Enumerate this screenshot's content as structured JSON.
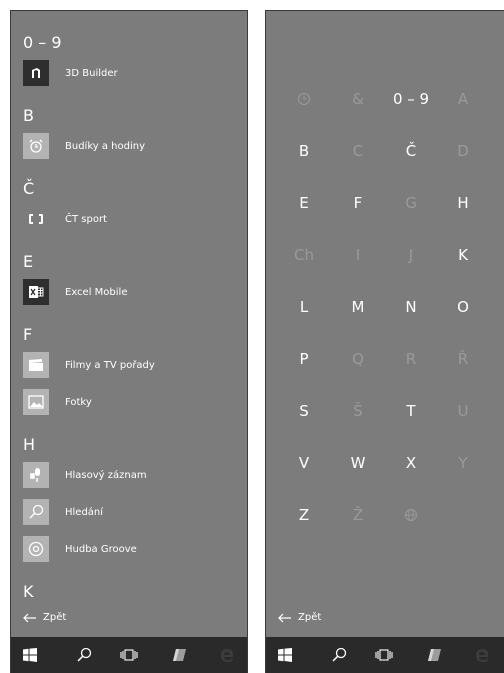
{
  "left_panel": {
    "groups": [
      {
        "letter": "0 – 9",
        "apps": [
          {
            "label": "3D Builder",
            "icon": "3d-builder-icon",
            "tile": "dark"
          }
        ]
      },
      {
        "letter": "B",
        "apps": [
          {
            "label": "Budíky a hodiny",
            "icon": "alarm-clock-icon",
            "tile": "light"
          }
        ]
      },
      {
        "letter": "Č",
        "apps": [
          {
            "label": "ČT sport",
            "icon": "ct-sport-icon",
            "tile": "none"
          }
        ]
      },
      {
        "letter": "E",
        "apps": [
          {
            "label": "Excel Mobile",
            "icon": "excel-icon",
            "tile": "dark"
          }
        ]
      },
      {
        "letter": "F",
        "apps": [
          {
            "label": "Filmy a TV pořady",
            "icon": "film-clapper-icon",
            "tile": "light"
          },
          {
            "label": "Fotky",
            "icon": "photos-icon",
            "tile": "light"
          }
        ]
      },
      {
        "letter": "H",
        "apps": [
          {
            "label": "Hlasový záznam",
            "icon": "microphone-icon",
            "tile": "light"
          },
          {
            "label": "Hledání",
            "icon": "search-icon",
            "tile": "light"
          },
          {
            "label": "Hudba Groove",
            "icon": "groove-music-icon",
            "tile": "light"
          }
        ]
      },
      {
        "letter": "K",
        "apps": []
      }
    ],
    "back_label": "Zpět"
  },
  "right_panel": {
    "grid": [
      [
        {
          "text": "",
          "icon": "recent-clock-icon",
          "active": false
        },
        {
          "text": "&",
          "active": false
        },
        {
          "text": "0 – 9",
          "active": true
        },
        {
          "text": "A",
          "active": false
        }
      ],
      [
        {
          "text": "B",
          "active": true
        },
        {
          "text": "C",
          "active": false
        },
        {
          "text": "Č",
          "active": true
        },
        {
          "text": "D",
          "active": false
        }
      ],
      [
        {
          "text": "E",
          "active": true
        },
        {
          "text": "F",
          "active": true
        },
        {
          "text": "G",
          "active": false
        },
        {
          "text": "H",
          "active": true
        }
      ],
      [
        {
          "text": "Ch",
          "active": false
        },
        {
          "text": "I",
          "active": false
        },
        {
          "text": "J",
          "active": false
        },
        {
          "text": "K",
          "active": true
        }
      ],
      [
        {
          "text": "L",
          "active": true
        },
        {
          "text": "M",
          "active": true
        },
        {
          "text": "N",
          "active": true
        },
        {
          "text": "O",
          "active": true
        }
      ],
      [
        {
          "text": "P",
          "active": true
        },
        {
          "text": "Q",
          "active": false
        },
        {
          "text": "R",
          "active": false
        },
        {
          "text": "Ř",
          "active": false
        }
      ],
      [
        {
          "text": "S",
          "active": true
        },
        {
          "text": "Š",
          "active": false
        },
        {
          "text": "T",
          "active": true
        },
        {
          "text": "U",
          "active": false
        }
      ],
      [
        {
          "text": "V",
          "active": true
        },
        {
          "text": "W",
          "active": true
        },
        {
          "text": "X",
          "active": true
        },
        {
          "text": "Y",
          "active": false
        }
      ],
      [
        {
          "text": "Z",
          "active": true
        },
        {
          "text": "Ž",
          "active": false
        },
        {
          "text": "",
          "icon": "globe-icon",
          "active": false
        }
      ]
    ],
    "back_label": "Zpět"
  },
  "taskbar": {
    "items": [
      "windows-start-icon",
      "search-icon",
      "task-view-icon",
      "notebook-app-icon",
      "edge-icon"
    ]
  }
}
